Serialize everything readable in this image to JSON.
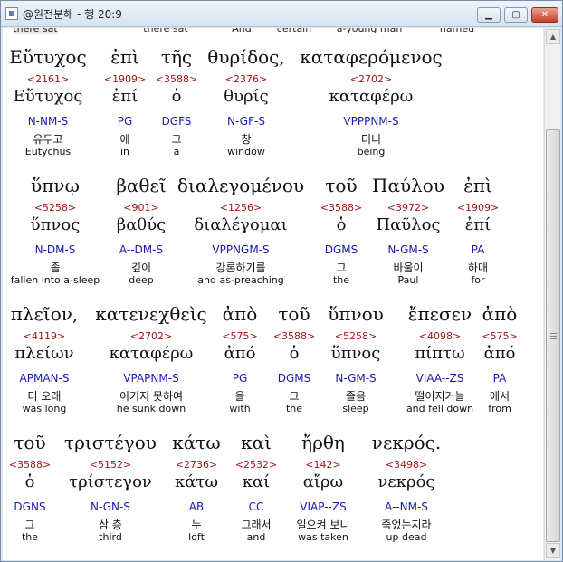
{
  "window": {
    "title": "@원전분해 - 행 20:9",
    "minimize_glyph": "▁",
    "maximize_glyph": "▢",
    "close_glyph": "✕"
  },
  "scrollbar": {
    "up_glyph": "▲",
    "down_glyph": "▼"
  },
  "top_partial": [
    "there sat",
    "there sat",
    "And",
    "certain",
    "a-young man",
    "named"
  ],
  "rows": [
    {
      "words": [
        {
          "greek": "Εὔτυχος",
          "strong": "<2161>",
          "lemma": "Εὔτυχος",
          "parse": "N-NM-S",
          "korean": "유두고",
          "english": "Eutychus"
        },
        {
          "greek": "ἐπὶ",
          "strong": "<1909>",
          "lemma": "ἐπί",
          "parse": "PG",
          "korean": "에",
          "english": "in"
        },
        {
          "greek": "τῆς",
          "strong": "<3588>",
          "lemma": "ὁ",
          "parse": "DGFS",
          "korean": "그",
          "english": "a"
        },
        {
          "greek": "θυρίδος,",
          "strong": "<2376>",
          "lemma": "θυρίς",
          "parse": "N-GF-S",
          "korean": "창",
          "english": "window"
        },
        {
          "greek": "καταφερόμενος",
          "strong": "<2702>",
          "lemma": "καταφέρω",
          "parse": "VPPPNM-S",
          "korean": "더니",
          "english": "being"
        }
      ]
    },
    {
      "words": [
        {
          "greek": "ὕπνῳ",
          "strong": "<5258>",
          "lemma": "ὕπνος",
          "parse": "N-DM-S",
          "korean": "졸",
          "english": "fallen into a-sleep"
        },
        {
          "greek": "βαθεῖ",
          "strong": "<901>",
          "lemma": "βαθύς",
          "parse": "A--DM-S",
          "korean": "깊이",
          "english": "deep"
        },
        {
          "greek": "διαλεγομένου",
          "strong": "<1256>",
          "lemma": "διαλέγομαι",
          "parse": "VPPNGM-S",
          "korean": "강론하기를",
          "english": "and as-preaching"
        },
        {
          "greek": "τοῦ",
          "strong": "<3588>",
          "lemma": "ὁ",
          "parse": "DGMS",
          "korean": "그",
          "english": "the"
        },
        {
          "greek": "Παύλου",
          "strong": "<3972>",
          "lemma": "Παῦλος",
          "parse": "N-GM-S",
          "korean": "바울이",
          "english": "Paul"
        },
        {
          "greek": "ἐπὶ",
          "strong": "<1909>",
          "lemma": "ἐπί",
          "parse": "PA",
          "korean": "하매",
          "english": "for"
        }
      ]
    },
    {
      "words": [
        {
          "greek": "πλεῖον,",
          "strong": "<4119>",
          "lemma": "πλείων",
          "parse": "APMAN-S",
          "korean": "더 오래",
          "english": "was long"
        },
        {
          "greek": "κατενεχθεὶς",
          "strong": "<2702>",
          "lemma": "καταφέρω",
          "parse": "VPAPNM-S",
          "korean": "이기지 못하여",
          "english": "he sunk down"
        },
        {
          "greek": "ἀπὸ",
          "strong": "<575>",
          "lemma": "ἀπό",
          "parse": "PG",
          "korean": "을",
          "english": "with"
        },
        {
          "greek": "τοῦ",
          "strong": "<3588>",
          "lemma": "ὁ",
          "parse": "DGMS",
          "korean": "그",
          "english": "the"
        },
        {
          "greek": "ὕπνου",
          "strong": "<5258>",
          "lemma": "ὕπνος",
          "parse": "N-GM-S",
          "korean": "졸음",
          "english": "sleep"
        },
        {
          "greek": "ἔπεσεν",
          "strong": "<4098>",
          "lemma": "πίπτω",
          "parse": "VIAA--ZS",
          "korean": "떨어지거늘",
          "english": "and fell down"
        },
        {
          "greek": "ἀπὸ",
          "strong": "<575>",
          "lemma": "ἀπό",
          "parse": "PA",
          "korean": "에서",
          "english": "from"
        }
      ]
    },
    {
      "words": [
        {
          "greek": "τοῦ",
          "strong": "<3588>",
          "lemma": "ὁ",
          "parse": "DGNS",
          "korean": "그",
          "english": "the"
        },
        {
          "greek": "τριστέγου",
          "strong": "<5152>",
          "lemma": "τρίστεγον",
          "parse": "N-GN-S",
          "korean": "삼 층",
          "english": "third"
        },
        {
          "greek": "κάτω",
          "strong": "<2736>",
          "lemma": "κάτω",
          "parse": "AB",
          "korean": "누",
          "english": "loft"
        },
        {
          "greek": "καὶ",
          "strong": "<2532>",
          "lemma": "καί",
          "parse": "CC",
          "korean": "그래서",
          "english": "and"
        },
        {
          "greek": "ἤρθη",
          "strong": "<142>",
          "lemma": "αἴρω",
          "parse": "VIAP--ZS",
          "korean": "일으켜 보니",
          "english": "was taken"
        },
        {
          "greek": "νεκρός.",
          "strong": "<3498>",
          "lemma": "νεκρός",
          "parse": "A--NM-S",
          "korean": "죽었는지라",
          "english": "up dead"
        }
      ]
    }
  ]
}
